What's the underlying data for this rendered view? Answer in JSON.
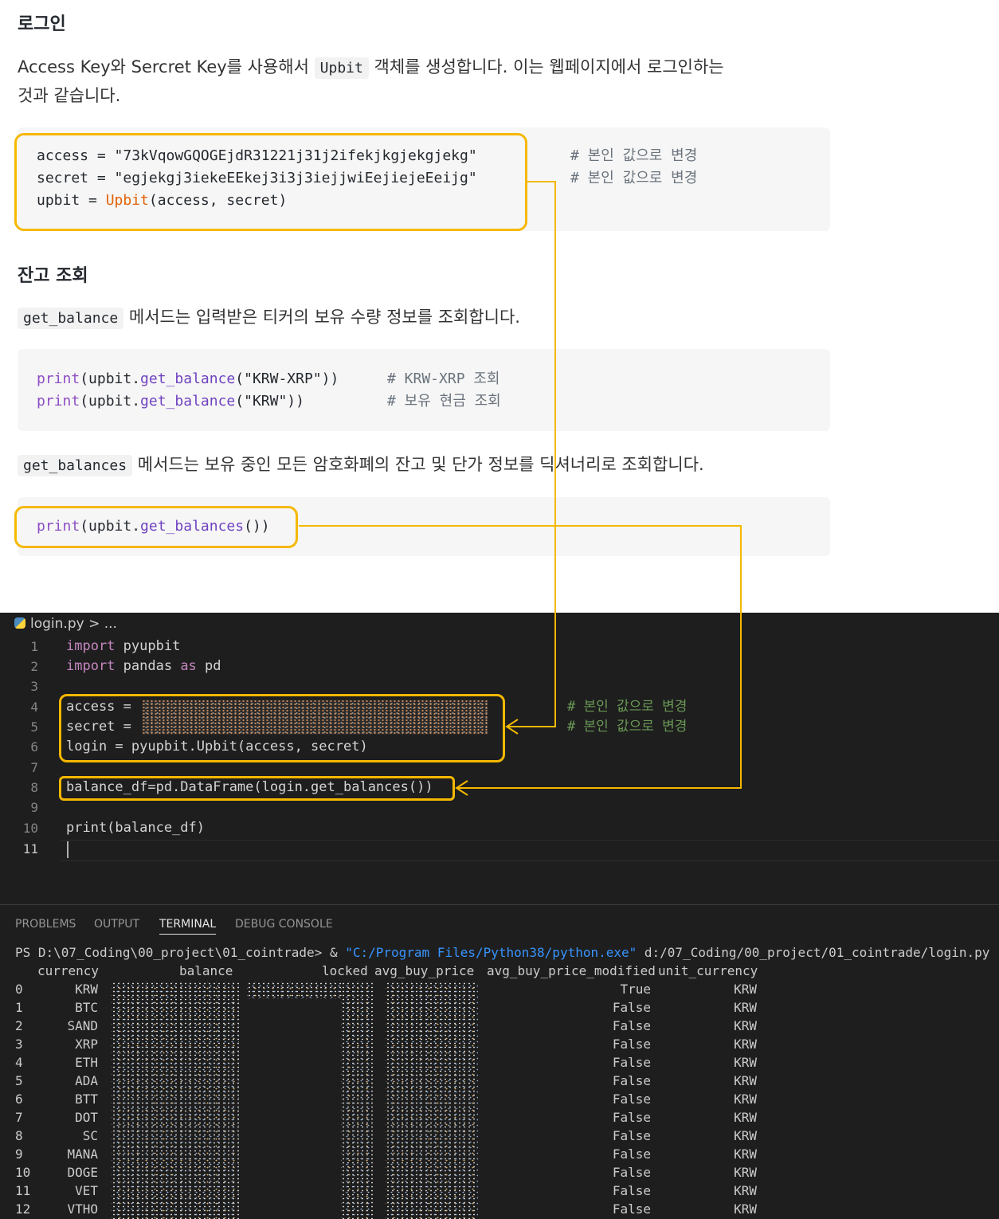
{
  "doc": {
    "login_heading": "로그인",
    "login_paragraph": {
      "before": "Access Key와 Sercret Key를 사용해서 ",
      "code": "Upbit",
      "after": " 객체를 생성합니다. 이는 웹페이지에서 로그인하는",
      "line2": "것과 같습니다."
    },
    "login_code": {
      "l1": "access = \"73kVqowGQOGEjdR31221j31j2ifekjkgjekgjekg\"",
      "l2": "secret = \"egjekgj3iekeEEkej3i3j3iejjwiEejiejeEeijg\"",
      "l3_var": "upbit = ",
      "l3_cls": "Upbit",
      "l3_args": "(access, secret)",
      "comment1": "# 본인 값으로 변경",
      "comment2": "# 본인 값으로 변경"
    },
    "balance_heading": "잔고 조회",
    "balance_paragraph": {
      "code": "get_balance",
      "text": " 메서드는 입력받은 티커의 보유 수량 정보를 조회합니다."
    },
    "balance_code": {
      "l1_fn": "print",
      "l1_a": "(upbit.",
      "l1_m": "get_balance",
      "l1_b": "(\"KRW-XRP\"))",
      "l2_fn": "print",
      "l2_a": "(upbit.",
      "l2_m": "get_balance",
      "l2_b": "(\"KRW\"))",
      "comment1": "# KRW-XRP 조회",
      "comment2": "# 보유 현금 조회"
    },
    "balances_paragraph": {
      "code": "get_balances",
      "text": " 메서드는 보유 중인 모든 암호화폐의 잔고 및 단가 정보를 딕셔너리로 조회합니다."
    },
    "balances_code": {
      "fn": "print",
      "a": "(upbit.",
      "m": "get_balances",
      "b": "())"
    }
  },
  "editor": {
    "breadcrumb": "login.py > ...",
    "line_numbers": [
      "1",
      "2",
      "3",
      "4",
      "5",
      "6",
      "7",
      "8",
      "9",
      "10",
      "11"
    ],
    "code": {
      "l1_kw": "import",
      "l1_rest": " pyupbit",
      "l2_kw": "import",
      "l2_mid": " pandas ",
      "l2_kw2": "as",
      "l2_rest": " pd",
      "l4": "access =",
      "l5": "secret =",
      "l6": "login = pyupbit.Upbit(access, secret)",
      "l8": "balance_df=pd.DataFrame(login.get_balances())",
      "l10": "print(balance_df)"
    },
    "comment1": "# 본인 값으로 변경",
    "comment2": "# 본인 값으로 변경"
  },
  "terminal": {
    "tabs": [
      "PROBLEMS",
      "OUTPUT",
      "TERMINAL",
      "DEBUG CONSOLE"
    ],
    "active_tab": "TERMINAL",
    "prompt": "PS D:\\07_Coding\\00_project\\01_cointrade> & ",
    "exe": "\"C:/Program Files/Python38/python.exe\"",
    "script": " d:/07_Coding/00_project/01_cointrade/login.py",
    "headers": {
      "currency": "currency",
      "balance": "balance",
      "locked": "locked",
      "avg_buy_price": "avg_buy_price",
      "avg_buy_price_modified": "avg_buy_price_modified",
      "unit_currency": "unit_currency"
    },
    "rows": [
      {
        "idx": "0",
        "currency": "KRW",
        "modified": "True",
        "unit": "KRW"
      },
      {
        "idx": "1",
        "currency": "BTC",
        "modified": "False",
        "unit": "KRW"
      },
      {
        "idx": "2",
        "currency": "SAND",
        "modified": "False",
        "unit": "KRW"
      },
      {
        "idx": "3",
        "currency": "XRP",
        "modified": "False",
        "unit": "KRW"
      },
      {
        "idx": "4",
        "currency": "ETH",
        "modified": "False",
        "unit": "KRW"
      },
      {
        "idx": "5",
        "currency": "ADA",
        "modified": "False",
        "unit": "KRW"
      },
      {
        "idx": "6",
        "currency": "BTT",
        "modified": "False",
        "unit": "KRW"
      },
      {
        "idx": "7",
        "currency": "DOT",
        "modified": "False",
        "unit": "KRW"
      },
      {
        "idx": "8",
        "currency": "SC",
        "modified": "False",
        "unit": "KRW"
      },
      {
        "idx": "9",
        "currency": "MANA",
        "modified": "False",
        "unit": "KRW"
      },
      {
        "idx": "10",
        "currency": "DOGE",
        "modified": "False",
        "unit": "KRW"
      },
      {
        "idx": "11",
        "currency": "VET",
        "modified": "False",
        "unit": "KRW"
      },
      {
        "idx": "12",
        "currency": "VTHO",
        "modified": "False",
        "unit": "KRW"
      }
    ]
  },
  "colors": {
    "highlight": "#f5b800",
    "editor_bg": "#1e1e1e",
    "code_block_bg": "#f6f6f6"
  }
}
